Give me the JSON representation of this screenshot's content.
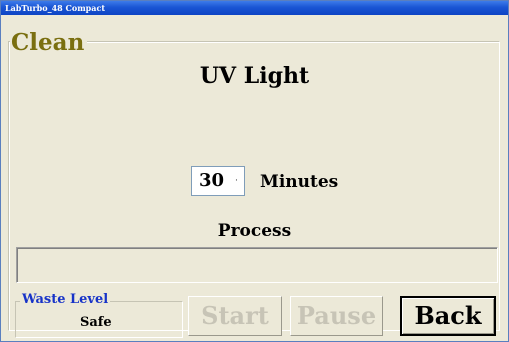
{
  "window": {
    "title": "LabTurbo_48 Compact"
  },
  "clean_group": {
    "label": "Clean"
  },
  "screen_title": "UV Light",
  "timer": {
    "value": "30",
    "spin_glyph": "·",
    "unit_label": "Minutes"
  },
  "process": {
    "label": "Process",
    "progress": 0
  },
  "waste_level": {
    "label": "Waste Level",
    "value": "Safe"
  },
  "buttons": {
    "start": {
      "label": "Start",
      "enabled": false
    },
    "pause": {
      "label": "Pause",
      "enabled": false
    },
    "back": {
      "label": "Back",
      "enabled": true
    }
  },
  "colors": {
    "titlebar": "#1a55d4",
    "clean_label": "#7a6f10",
    "waste_label": "#1733c8",
    "disabled_text": "#c7c4b6",
    "background": "#ece9d8"
  }
}
